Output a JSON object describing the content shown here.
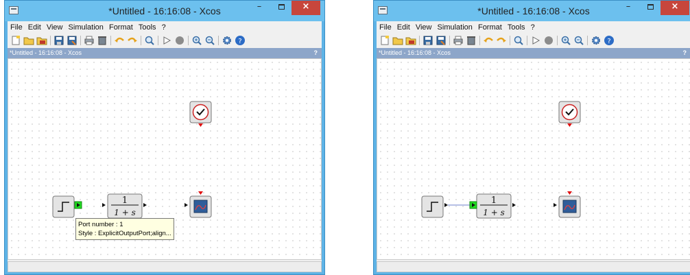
{
  "windows": [
    {
      "title": "*Untitled - 16:16:08 - Xcos",
      "menu": [
        "File",
        "Edit",
        "View",
        "Simulation",
        "Format",
        "Tools",
        "?"
      ],
      "tab_title": "*Untitled - 16:16:08 - Xcos",
      "tab_help": "?",
      "close_glyph": "×",
      "minimize_glyph": "–",
      "transfer_fcn": {
        "numerator": "1",
        "denominator": "1 + s"
      },
      "tooltip": {
        "line1": "Port number : 1",
        "line2": "Style : ExplicitOutputPort;align..."
      },
      "step_link_connected": false
    },
    {
      "title": "*Untitled - 16:16:08 - Xcos",
      "menu": [
        "File",
        "Edit",
        "View",
        "Simulation",
        "Format",
        "Tools",
        "?"
      ],
      "tab_title": "*Untitled - 16:16:08 - Xcos",
      "tab_help": "?",
      "close_glyph": "×",
      "minimize_glyph": "–",
      "transfer_fcn": {
        "numerator": "1",
        "denominator": "1 + s"
      },
      "step_link_connected": true
    }
  ],
  "toolbar_icons": [
    "new-diagram-icon",
    "open-icon",
    "open-in-scilab-icon",
    "save-icon",
    "save-as-icon",
    "print-icon",
    "delete-icon",
    "undo-icon",
    "redo-icon",
    "fit-diagram-icon",
    "start-icon",
    "stop-icon",
    "zoom-in-icon",
    "zoom-out-icon",
    "xcos-demos-icon",
    "help-icon"
  ],
  "colors": {
    "titlebar": "#6cc0ee",
    "tabbar": "#8da6c9",
    "close_button": "#c7463c",
    "port_out": "#000000",
    "event_port": "#e01010",
    "selected_port": "#22dd22",
    "link": "#8a9ad6"
  }
}
